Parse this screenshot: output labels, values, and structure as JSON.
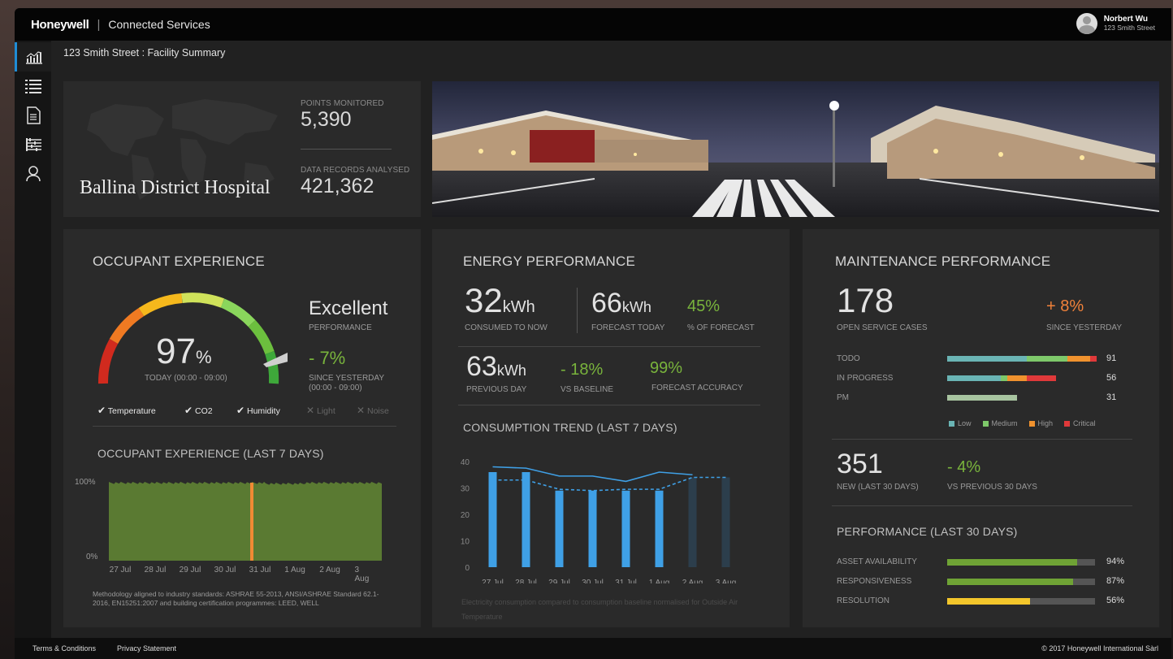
{
  "header": {
    "brand": "Honeywell",
    "separator": "|",
    "app_name": "Connected Services",
    "user_name": "Norbert Wu",
    "user_address": "123 Smith Street"
  },
  "sidebar": {
    "items": [
      {
        "icon": "chart-icon",
        "active": true
      },
      {
        "icon": "list-icon"
      },
      {
        "icon": "document-icon"
      },
      {
        "icon": "filter-list-icon"
      },
      {
        "icon": "user-icon"
      }
    ]
  },
  "breadcrumb": "123 Smith Street : Facility Summary",
  "facility": {
    "name": "Ballina District Hospital",
    "points_label": "POINTS MONITORED",
    "points_value": "5,390",
    "records_label": "DATA RECORDS ANALYSED",
    "records_value": "421,362"
  },
  "occupant": {
    "title": "OCCUPANT EXPERIENCE",
    "score": "97",
    "score_unit": "%",
    "score_caption": "TODAY (00:00 - 09:00)",
    "rating": "Excellent",
    "rating_label": "PERFORMANCE",
    "change": "- 7%",
    "change_label": "SINCE YESTERDAY",
    "change_range": "(00:00 - 09:00)",
    "checks": [
      {
        "label": "Temperature",
        "mark": "✔",
        "enabled": true
      },
      {
        "label": "CO2",
        "mark": "✔",
        "enabled": true
      },
      {
        "label": "Humidity",
        "mark": "✔",
        "enabled": true
      },
      {
        "label": "Light",
        "mark": "✕",
        "enabled": false
      },
      {
        "label": "Noise",
        "mark": "✕",
        "enabled": false
      }
    ],
    "trend_title": "OCCUPANT EXPERIENCE (LAST 7 DAYS)",
    "trend_ymax": "100%",
    "trend_ymin": "0%",
    "trend_dates": [
      "27 Jul",
      "28 Jul",
      "29 Jul",
      "30 Jul",
      "31 Jul",
      "1 Aug",
      "2 Aug",
      "3 Aug"
    ],
    "note": "Methodology aligned to industry standards: ASHRAE 55-2013, ANSI/ASHRAE Standard 62.1-2016, EN15251:2007 and building certification programmes: LEED, WELL"
  },
  "energy": {
    "title": "ENERGY PERFORMANCE",
    "consumed_value": "32",
    "consumed_unit": "kWh",
    "consumed_label": "CONSUMED TO NOW",
    "forecast_value": "66",
    "forecast_unit": "kWh",
    "forecast_label": "FORECAST TODAY",
    "pct_value": "45%",
    "pct_label": "% OF FORECAST",
    "prev_value": "63",
    "prev_unit": "kWh",
    "prev_label": "PREVIOUS DAY",
    "baseline_value": "- 18%",
    "baseline_label": "VS BASELINE",
    "accuracy_value": "99%",
    "accuracy_label": "FORECAST ACCURACY",
    "trend_title": "CONSUMPTION TREND (LAST 7 DAYS)",
    "note": "Electricity consumption compared to consumption baseline normalised for Outside Air Temperature"
  },
  "maintenance": {
    "title": "MAINTENANCE PERFORMANCE",
    "open_value": "178",
    "open_label": "OPEN SERVICE CASES",
    "change_value": "+ 8%",
    "change_label": "SINCE YESTERDAY",
    "rows": [
      {
        "label": "TODO",
        "count": "91"
      },
      {
        "label": "IN PROGRESS",
        "count": "56"
      },
      {
        "label": "PM",
        "count": "31"
      }
    ],
    "legend": [
      {
        "label": "Low",
        "color": "#6ab4b4"
      },
      {
        "label": "Medium",
        "color": "#7ec86a"
      },
      {
        "label": "High",
        "color": "#f0922e"
      },
      {
        "label": "Critical",
        "color": "#e0393a"
      }
    ],
    "new_value": "351",
    "new_label": "NEW (LAST 30 DAYS)",
    "vs_value": "- 4%",
    "vs_label": "VS PREVIOUS 30 DAYS",
    "perf_title": "PERFORMANCE  (LAST 30 DAYS)",
    "perf": [
      {
        "label": "ASSET AVAILABILITY",
        "value": "94%",
        "fraction": 0.88,
        "color": "#6fa335"
      },
      {
        "label": "RESPONSIVENESS",
        "value": "87%",
        "fraction": 0.85,
        "color": "#6fa335"
      },
      {
        "label": "RESOLUTION",
        "value": "56%",
        "fraction": 0.56,
        "color": "#f3c62b"
      }
    ]
  },
  "footer": {
    "terms": "Terms & Conditions",
    "privacy": "Privacy Statement",
    "copyright": "© 2017 Honeywell International Sàrl"
  },
  "chart_data": [
    {
      "type": "bar",
      "title": "CONSUMPTION TREND (LAST 7 DAYS)",
      "categories": [
        "27 Jul",
        "28 Jul",
        "29 Jul",
        "30 Jul",
        "31 Jul",
        "1 Aug",
        "2 Aug",
        "3 Aug"
      ],
      "yticks": [
        0,
        10,
        20,
        30,
        40
      ],
      "ylim": [
        0,
        40
      ],
      "series": [
        {
          "type": "bar",
          "values": [
            36,
            36,
            29,
            29,
            29,
            29,
            29,
            null
          ],
          "color": "#3fa0e6"
        },
        {
          "type": "bar",
          "values": [
            null,
            null,
            null,
            null,
            null,
            null,
            34,
            34
          ],
          "color": "#2c3e4c"
        },
        {
          "type": "line",
          "values": [
            38,
            37.5,
            34.5,
            34.5,
            32.5,
            36,
            35,
            null
          ],
          "color": "#3fa0e6"
        },
        {
          "type": "dashed-line",
          "values": [
            33,
            33,
            29.5,
            29,
            29.5,
            29.5,
            34,
            34
          ],
          "color": "#3fa0e6"
        }
      ]
    },
    {
      "type": "area",
      "title": "OCCUPANT EXPERIENCE (LAST 7 DAYS)",
      "categories": [
        "27 Jul",
        "28 Jul",
        "29 Jul",
        "30 Jul",
        "31 Jul",
        "1 Aug",
        "2 Aug",
        "3 Aug"
      ],
      "ylim": [
        0,
        100
      ],
      "values": [
        97,
        97,
        97,
        97,
        96,
        97,
        97,
        97
      ]
    }
  ]
}
